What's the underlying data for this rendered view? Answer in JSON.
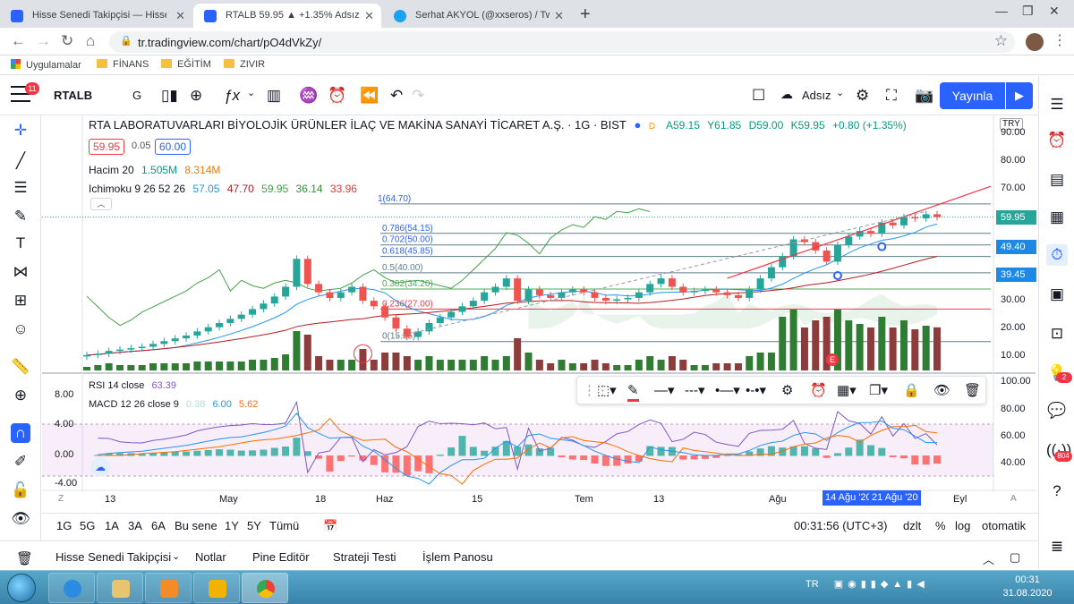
{
  "browser": {
    "tabs": [
      {
        "label": "Hisse Senedi Takipçisi — Hisseler"
      },
      {
        "label": "RTALB 59.95 ▲ +1.35% Adsız"
      },
      {
        "label": "Serhat AKYOL (@xxseros) / Twitter"
      }
    ],
    "url": "tr.tradingview.com/chart/pO4dVkZy/",
    "bookmarks": [
      "Uygulamalar",
      "FİNANS",
      "EĞİTİM",
      "ZIVIR"
    ]
  },
  "toolbar": {
    "menu_badge": "11",
    "symbol": "RTALB",
    "interval": "G",
    "layout_name": "Adsız",
    "publish_label": "Yayınla"
  },
  "chart": {
    "header": "RTA LABORATUVARLARI BİYOLOJİK ÜRÜNLER İLAÇ VE MAKİNA SANAYİ TİCARET A.Ş. · 1G · BIST",
    "ohlc": {
      "o": "A59.15",
      "h": "Y61.85",
      "l": "D59.00",
      "c": "K59.95",
      "change": "+0.80 (+1.35%)"
    },
    "bid": "59.95",
    "spread": "0.05",
    "ask": "60.00",
    "volume_legend": {
      "name": "Hacim 20",
      "v1": "1.505M",
      "v2": "8.314M"
    },
    "ichimoku_legend": {
      "name": "Ichimoku 9 26 52 26",
      "v1": "57.05",
      "v2": "47.70",
      "v3": "59.95",
      "v4": "36.14",
      "v5": "33.96"
    },
    "rsi_legend": {
      "name": "RSI 14 close",
      "value": "63.39"
    },
    "macd_legend": {
      "name": "MACD 12 26 close 9",
      "v1": "0.38",
      "v2": "6.00",
      "v3": "5.62"
    },
    "currency": "TRY",
    "price_axis": [
      "90.00",
      "80.00",
      "70.00",
      "60.00",
      "50.00",
      "40.00",
      "30.00",
      "20.00",
      "10.00"
    ],
    "price_tags": [
      {
        "value": "59.95",
        "color": "#26a69a"
      },
      {
        "value": "49.40",
        "color": "#1e88e5"
      },
      {
        "value": "39.45",
        "color": "#1e88e5"
      }
    ],
    "rsi_axis": [
      "100.00",
      "80.00",
      "60.00",
      "40.00"
    ],
    "macd_axis": [
      "8.00",
      "4.00",
      "0.00",
      "-4.00"
    ],
    "time_axis": [
      "13",
      "May",
      "18",
      "Haz",
      "15",
      "Tem",
      "13",
      "Ağu",
      "Eyl"
    ],
    "time_highlight": [
      "14 Ağu '20",
      "21 Ağu '20"
    ],
    "fib_levels": [
      {
        "label": "1(64.70)",
        "price": 64.7
      },
      {
        "label": "0.786(54.15)",
        "price": 54.15
      },
      {
        "label": "0.702(50.00)",
        "price": 50.0
      },
      {
        "label": "0.618(45.85)",
        "price": 45.85
      },
      {
        "label": "0.5(40.00)",
        "price": 40.0
      },
      {
        "label": "0.382(34.20)",
        "price": 34.2
      },
      {
        "label": "0.236(27.00)",
        "price": 27.0
      },
      {
        "label": "0(15.35)",
        "price": 15.35
      }
    ],
    "event_marker": "E"
  },
  "chart_data": {
    "type": "candlestick",
    "symbol": "RTALB",
    "ylim": [
      0,
      90
    ],
    "closes": [
      10.5,
      11,
      12,
      12.5,
      13,
      13.5,
      14.5,
      15.5,
      16.5,
      17.5,
      19,
      20.5,
      22,
      23.5,
      25,
      27,
      29,
      31.5,
      35,
      45,
      36,
      33,
      31,
      33,
      35,
      30,
      28,
      24,
      20,
      17,
      19,
      22,
      24,
      26,
      28,
      30,
      33,
      35,
      38,
      30,
      34,
      32,
      31,
      33,
      34,
      33,
      31,
      30,
      30.5,
      31,
      33,
      36,
      38,
      35,
      33,
      33.5,
      34,
      33,
      32,
      31,
      34,
      38,
      42,
      46,
      52,
      51,
      48,
      44,
      50,
      53,
      55,
      54,
      58,
      57,
      60,
      59.5,
      61,
      59.95
    ],
    "volume_note": "Hacim 20"
  },
  "drawbar": {},
  "ranges": [
    "1G",
    "5G",
    "1A",
    "3A",
    "6A",
    "Bu sene",
    "1Y",
    "5Y",
    "Tümü"
  ],
  "status": {
    "clock": "00:31:56 (UTC+3)",
    "adj": "dzlt",
    "pct": "%",
    "log": "log",
    "auto": "otomatik"
  },
  "panels": [
    "Hisse Senedi Takipçisi",
    "Notlar",
    "Pine Editör",
    "Strateji Testi",
    "İşlem Panosu"
  ],
  "right_badges": [
    "2",
    "804"
  ],
  "taskbar": {
    "lang": "TR",
    "time": "00:31",
    "date": "31.08.2020"
  }
}
